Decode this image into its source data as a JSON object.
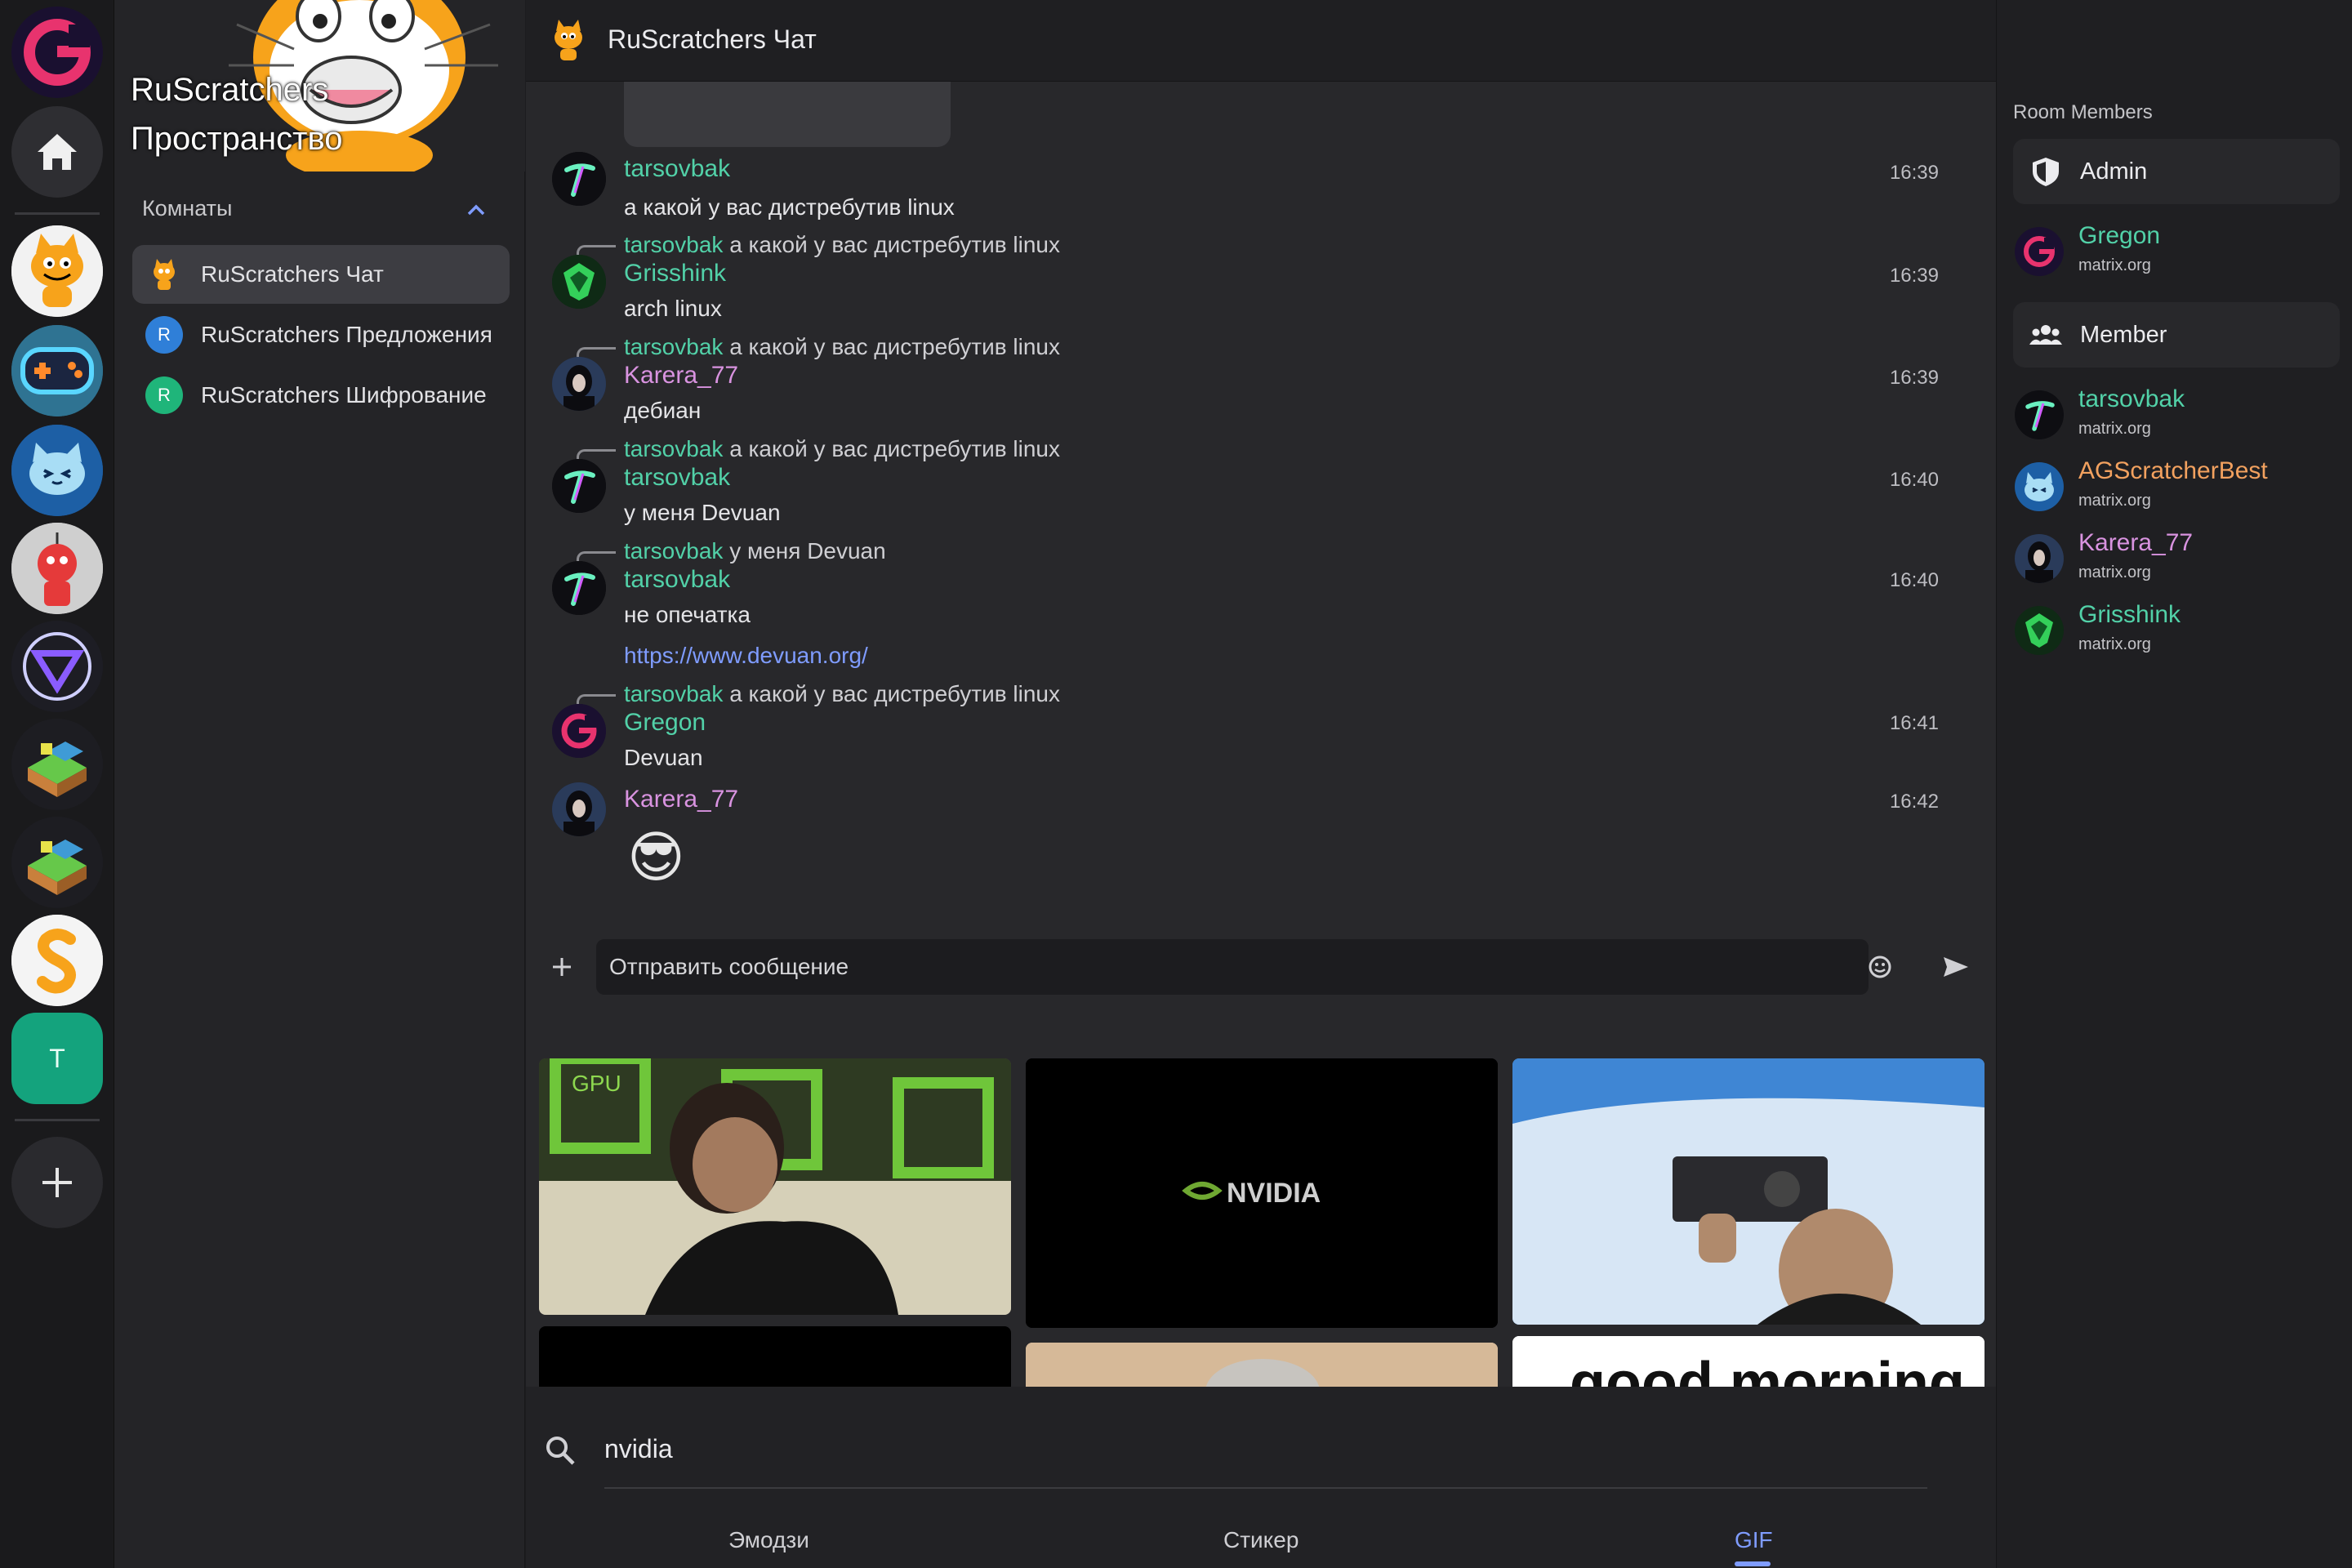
{
  "space": {
    "title": "RuScratchers Пространство"
  },
  "sidebar": {
    "section_label": "Комнаты",
    "rooms": [
      {
        "name": "RuScratchers Чат",
        "icon": "scratch-cat-icon",
        "active": true
      },
      {
        "name": "RuScratchers Предложения",
        "letter": "R",
        "color": "#2f7fd8"
      },
      {
        "name": "RuScratchers Шифрование",
        "letter": "R",
        "color": "#1fb57a"
      }
    ]
  },
  "rail": {
    "home_icon": "home-icon",
    "t_space_letter": "T",
    "add_icon": "plus-icon"
  },
  "header": {
    "room_title": "RuScratchers Чат"
  },
  "messages": [
    {
      "sender": "tarsovbak",
      "color": "#52d1a8",
      "time": "16:39",
      "body": "а какой у вас дистребутив linux"
    },
    {
      "reply_sender": "tarsovbak",
      "reply_text": "а какой у вас дистребутив linux",
      "sender": "Grisshink",
      "color": "#52d1a8",
      "time": "16:39",
      "body": "arch linux"
    },
    {
      "reply_sender": "tarsovbak",
      "reply_text": "а какой у вас дистребутив linux",
      "sender": "Karera_77",
      "color": "#d993e0",
      "time": "16:39",
      "body": "дебиан"
    },
    {
      "reply_sender": "tarsovbak",
      "reply_text": "а какой у вас дистребутив linux",
      "sender": "tarsovbak",
      "color": "#52d1a8",
      "time": "16:40",
      "body": "у меня Devuan"
    },
    {
      "reply_sender": "tarsovbak",
      "reply_text": "у меня Devuan",
      "sender": "tarsovbak",
      "color": "#52d1a8",
      "time": "16:40",
      "body": "не опечатка",
      "link": "https://www.devuan.org/"
    },
    {
      "reply_sender": "tarsovbak",
      "reply_text": "а какой у вас дистребутив linux",
      "sender": "Gregon",
      "color": "#52d1a8",
      "time": "16:41",
      "body": "Devuan"
    },
    {
      "sender": "Karera_77",
      "color": "#d993e0",
      "time": "16:42",
      "emoji": "😎"
    }
  ],
  "composer": {
    "placeholder": "Отправить сообщение"
  },
  "picker": {
    "search_value": "nvidia",
    "tabs": [
      "Эмодзи",
      "Стикер",
      "GIF"
    ],
    "active_tab": "GIF",
    "gif_texts": {
      "nvidia_logo": "NVIDIA",
      "good_morning": "good morning",
      "gpu": "GPU"
    }
  },
  "members": {
    "title": "Room Members",
    "roles": [
      {
        "label": "Admin",
        "icon": "shield-icon",
        "users": [
          {
            "name": "Gregon",
            "server": "matrix.org",
            "color": "#52d1a8"
          }
        ]
      },
      {
        "label": "Member",
        "icon": "group-icon",
        "users": [
          {
            "name": "tarsovbak",
            "server": "matrix.org",
            "color": "#52d1a8"
          },
          {
            "name": "AGScratcherBest",
            "server": "matrix.org",
            "color": "#f2a15f"
          },
          {
            "name": "Karera_77",
            "server": "matrix.org",
            "color": "#d993e0"
          },
          {
            "name": "Grisshink",
            "server": "matrix.org",
            "color": "#52d1a8"
          }
        ]
      }
    ]
  }
}
